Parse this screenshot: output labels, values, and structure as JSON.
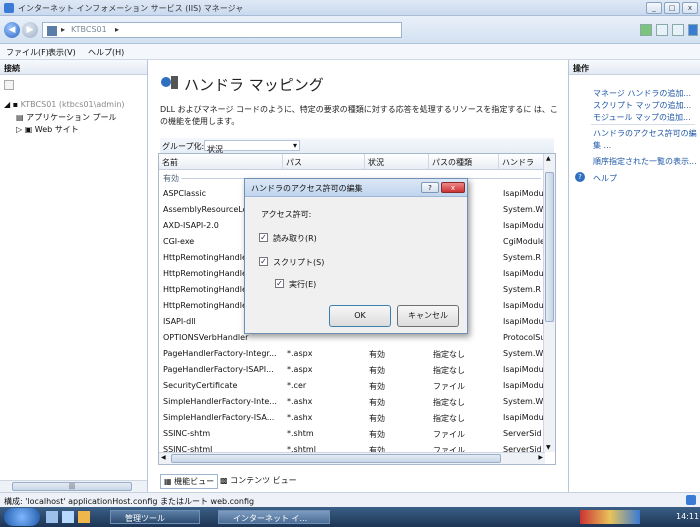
{
  "window": {
    "title": "インターネット インフォメーション サービス (IIS) マネージャ"
  },
  "address": {
    "segments": [
      "",
      "KTBCS01",
      ""
    ]
  },
  "menu": [
    "ファイル(F)",
    "表示(V)",
    "ヘルプ(H)"
  ],
  "left": {
    "header": "接続",
    "tree": [
      "KTBCS01 (ktbcs01\\admin)",
      "アプリケーション プール",
      "Web サイト"
    ]
  },
  "main": {
    "title": "ハンドラ マッピング",
    "description": "DLL およびマネージ コードのように、特定の要求の種類に対する応答を処理するリソースを指定するに は、この機能を使用します。",
    "group_label": "グループ化:",
    "group_value": "状況",
    "columns": [
      "名前",
      "パス",
      "状況",
      "パスの種類",
      "ハンドラ"
    ],
    "group_row": "有効",
    "rows": [
      [
        "ASPClassic",
        "",
        "",
        "",
        "IsapiModu"
      ],
      [
        "AssemblyResourceLo",
        "",
        "",
        "",
        "System.W"
      ],
      [
        "AXD-ISAPI-2.0",
        "",
        "",
        "",
        "IsapiModu"
      ],
      [
        "CGI-exe",
        "",
        "",
        "",
        "CgiModule"
      ],
      [
        "HttpRemotingHandler",
        "",
        "",
        "",
        "System.R"
      ],
      [
        "HttpRemotingHandler",
        "",
        "",
        "",
        "IsapiModu"
      ],
      [
        "HttpRemotingHandler",
        "",
        "",
        "",
        "System.R"
      ],
      [
        "HttpRemotingHandler",
        "",
        "",
        "",
        "IsapiModu"
      ],
      [
        "ISAPI-dll",
        "",
        "",
        "",
        "IsapiModu"
      ],
      [
        "OPTIONSVerbHandler",
        "",
        "",
        "",
        "ProtocolSu"
      ],
      [
        "PageHandlerFactory-Integr...",
        "*.aspx",
        "有効",
        "指定なし",
        "System.W"
      ],
      [
        "PageHandlerFactory-ISAPI...",
        "*.aspx",
        "有効",
        "指定なし",
        "IsapiModu"
      ],
      [
        "SecurityCertificate",
        "*.cer",
        "有効",
        "ファイル",
        "IsapiModu"
      ],
      [
        "SimpleHandlerFactory-Inte...",
        "*.ashx",
        "有効",
        "指定なし",
        "System.W"
      ],
      [
        "SimpleHandlerFactory-ISA...",
        "*.ashx",
        "有効",
        "指定なし",
        "IsapiModu"
      ],
      [
        "SSINC-shtm",
        "*.shtm",
        "有効",
        "ファイル",
        "ServerSid"
      ],
      [
        "SSINC-shtml",
        "*.shtml",
        "有効",
        "ファイル",
        "ServerSid"
      ]
    ],
    "view_tabs": [
      "機能ビュー",
      "コンテンツ ビュー"
    ]
  },
  "right": {
    "header": "操作",
    "actions": [
      "マネージ ハンドラの追加...",
      "スクリプト マップの追加...",
      "モジュール マップの追加...",
      "ハンドラのアクセス許可の編",
      "集 ...",
      "順序指定された一覧の表示..."
    ],
    "help": "ヘルプ"
  },
  "dialog": {
    "title": "ハンドラのアクセス許可の編集",
    "help_btn": "?",
    "close_btn": "x",
    "label": "アクセス許可:",
    "read": "読み取り(R)",
    "script": "スクリプト(S)",
    "execute": "実行(E)",
    "ok": "OK",
    "cancel": "キャンセル"
  },
  "status": "構成: 'localhost' applicationHost.config またはルート web.config",
  "taskbar": {
    "items": [
      "管理ツール",
      "インターネット イ..."
    ],
    "time": "14:11"
  },
  "colors": {
    "accent": "#1c56a6",
    "title_bar": "#c9d9ee"
  }
}
